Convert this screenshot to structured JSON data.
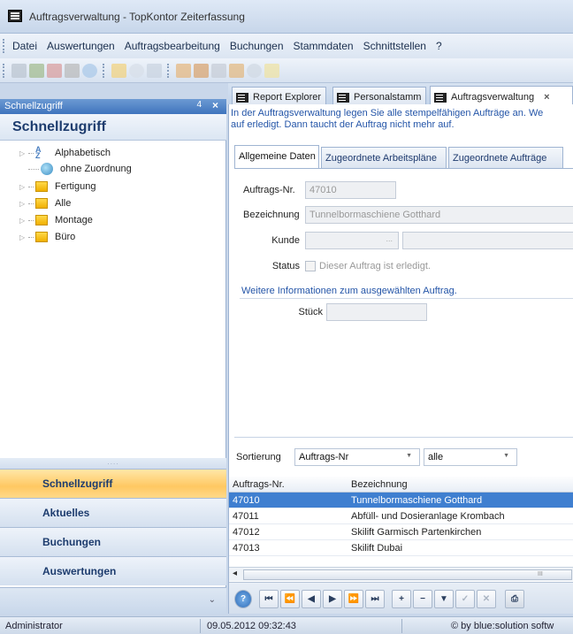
{
  "window": {
    "title": "Auftragsverwaltung - TopKontor Zeiterfassung"
  },
  "menu": [
    "Datei",
    "Auswertungen",
    "Auftragsbearbeitung",
    "Buchungen",
    "Stammdaten",
    "Schnittstellen",
    "?"
  ],
  "left_panel": {
    "header": "Schnellzugriff",
    "pin": "4",
    "close": "×",
    "title": "Schnellzugriff",
    "tree": [
      {
        "label": "Alphabetisch",
        "icon": "az-sort-icon"
      },
      {
        "label": "ohne Zuordnung",
        "icon": "globe-icon"
      },
      {
        "label": "Fertigung",
        "icon": "folder-icon"
      },
      {
        "label": "Alle",
        "icon": "folder-icon"
      },
      {
        "label": "Montage",
        "icon": "folder-icon"
      },
      {
        "label": "Büro",
        "icon": "folder-icon"
      }
    ],
    "splitter_dots": "....",
    "nav": [
      "Schnellzugriff",
      "Aktuelles",
      "Buchungen",
      "Auswertungen"
    ],
    "nav_active": "Schnellzugriff"
  },
  "tabs": [
    {
      "label": "Report Explorer"
    },
    {
      "label": "Personalstamm"
    },
    {
      "label": "Auftragsverwaltung",
      "close": "×",
      "active": true
    }
  ],
  "info": {
    "line1": "In der Auftragsverwaltung legen Sie alle stempelfähigen Aufträge an. We",
    "line2": "auf erledigt. Dann taucht der Auftrag nicht mehr auf."
  },
  "inner_tabs": [
    "Allgemeine Daten",
    "Zugeordnete Arbeitspläne",
    "Zugeordnete Aufträge"
  ],
  "form": {
    "auftrags_nr_label": "Auftrags-Nr.",
    "auftrags_nr_value": "47010",
    "bezeichnung_label": "Bezeichnung",
    "bezeichnung_value": "Tunnelbormaschiene Gotthard",
    "kunde_label": "Kunde",
    "kunde_ellipsis": "...",
    "status_label": "Status",
    "status_checkbox_text": "Dieser Auftrag ist erledigt.",
    "more_info": "Weitere Informationen zum ausgewählten Auftrag.",
    "stueck_label": "Stück"
  },
  "sort": {
    "label": "Sortierung",
    "value": "Auftrags-Nr",
    "filter_value": "alle"
  },
  "grid": {
    "columns": [
      "Auftrags-Nr.",
      "Bezeichnung"
    ],
    "rows": [
      {
        "nr": "47010",
        "bez": "Tunnelbormaschiene Gotthard",
        "selected": true
      },
      {
        "nr": "47011",
        "bez": "Abfüll- und Dosieranlage Krombach"
      },
      {
        "nr": "47012",
        "bez": "Skilift Garmisch Partenkirchen"
      },
      {
        "nr": "47013",
        "bez": "Skilift Dubai"
      }
    ],
    "scroll_grip": "III"
  },
  "navigator": [
    "⏮",
    "⏪",
    "◀",
    "▶",
    "⏩",
    "⏭",
    "+",
    "−",
    "▼",
    "✓",
    "✕"
  ],
  "status": {
    "user": "Administrator",
    "datetime": "09.05.2012 09:32:43",
    "copyright": "© by blue:solution softw"
  },
  "colors": {
    "accent": "#3f7fd0",
    "active_nav": "#ffc862",
    "panel_header": "#3f74bd"
  }
}
